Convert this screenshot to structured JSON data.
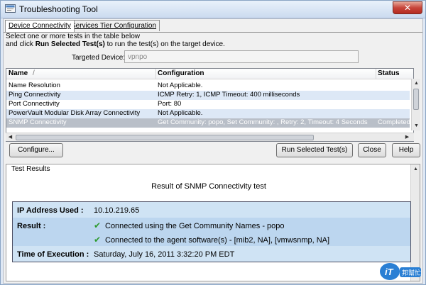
{
  "window": {
    "title": "Troubleshooting Tool",
    "close_glyph": "✕"
  },
  "tabs": [
    {
      "label": "Device Connectivity",
      "active": true
    },
    {
      "label": "Services Tier Configuration",
      "active": false
    }
  ],
  "instructions": {
    "line1": "Select one or more tests in the table below",
    "line2_prefix": "and click ",
    "line2_bold": "Run Selected Test(s)",
    "line2_suffix": " to run the test(s) on the target device."
  },
  "target": {
    "label": "Targeted Device:",
    "value": "vpnpo"
  },
  "table": {
    "headers": {
      "name": "Name",
      "configuration": "Configuration",
      "status": "Status"
    },
    "sort_glyph": "/",
    "rows": [
      {
        "name": "Name Resolution",
        "configuration": "Not Applicable.",
        "status": ""
      },
      {
        "name": "Ping Connectivity",
        "configuration": "ICMP Retry: 1, ICMP Timeout: 400 milliseconds",
        "status": ""
      },
      {
        "name": "Port Connectivity",
        "configuration": "Port: 80",
        "status": ""
      },
      {
        "name": "PowerVault Modular Disk Array Connectivity",
        "configuration": "Not Applicable.",
        "status": ""
      },
      {
        "name": "SNMP Connectivity",
        "configuration": "Get Community: popo, Set Community: , Retry: 2, Timeout: 4 Seconds",
        "status": "Completed. T"
      }
    ]
  },
  "buttons": {
    "configure": "Configure...",
    "run": "Run Selected Test(s)",
    "close": "Close",
    "help": "Help"
  },
  "results": {
    "legend": "Test Results",
    "title": "Result of SNMP Connectivity test",
    "ip_label": "IP Address Used :",
    "ip_value": "10.10.219.65",
    "result_label": "Result :",
    "result_line1": "Connected using the Get Community Names - popo",
    "result_line2": "Connected to the agent software(s) - [mib2, NA], [vmwsnmp, NA]",
    "time_label": "Time of Execution :",
    "time_value": "Saturday, July 16, 2011 3:32:20 PM EDT"
  },
  "watermark": {
    "text": "iT 邦幫忙"
  },
  "icons": {
    "check": "✔"
  },
  "colors": {
    "selected_row": "#b9bfc8",
    "alt_row": "#dde8f6",
    "result_box": "#cfe3f4"
  }
}
